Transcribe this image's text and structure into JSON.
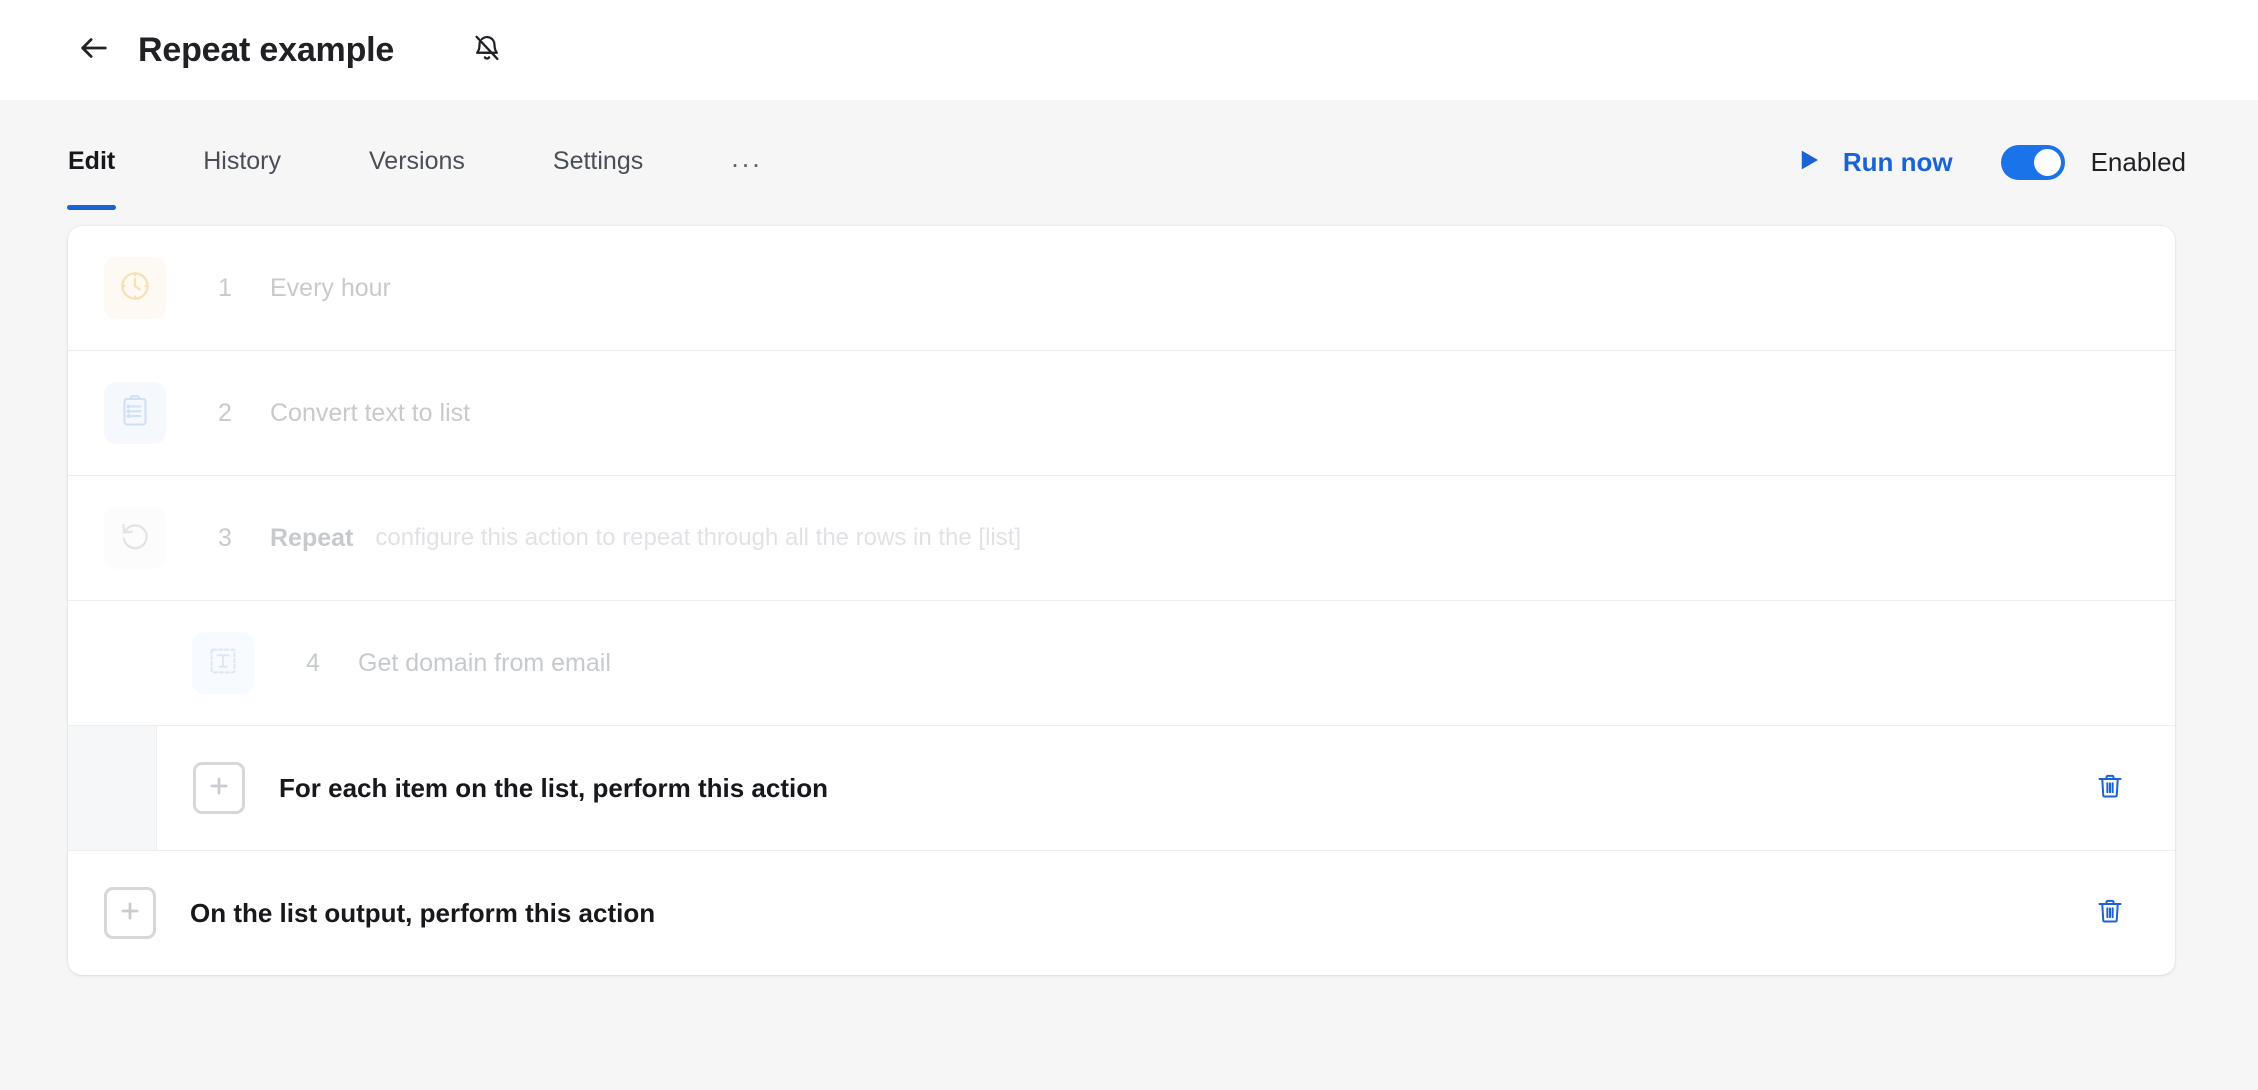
{
  "header": {
    "back_icon": "arrow-left-icon",
    "title": "Repeat example",
    "notification_icon": "bell-off-icon"
  },
  "tabbar": {
    "tabs": [
      {
        "label": "Edit",
        "active": true
      },
      {
        "label": "History",
        "active": false
      },
      {
        "label": "Versions",
        "active": false
      },
      {
        "label": "Settings",
        "active": false
      }
    ],
    "overflow_label": "...",
    "run_now": {
      "label": "Run now",
      "icon": "play-icon",
      "color": "#1a62d6"
    },
    "toggle": {
      "label": "Enabled",
      "on": true,
      "color": "#1a73e8"
    },
    "active_underline_color": "#1a62d6"
  },
  "workflow": {
    "steps": [
      {
        "number": "1",
        "title": "Every hour",
        "subtitle": "",
        "icon": "clock-icon",
        "tile_color": "#fdf4e3",
        "indent": false,
        "dimmed": true
      },
      {
        "number": "2",
        "title": "Convert text to list",
        "subtitle": "",
        "icon": "clipboard-list-icon",
        "tile_color": "#e9f1fd",
        "indent": false,
        "dimmed": true
      },
      {
        "number": "3",
        "title": "Repeat",
        "subtitle": "configure this action to repeat through all the rows in the [list]",
        "icon": "repeat-rotate-icon",
        "tile_color": "#fafafb",
        "indent": false,
        "dimmed": true
      },
      {
        "number": "4",
        "title": "Get domain from email",
        "subtitle": "",
        "icon": "text-select-icon",
        "tile_color": "#eef5fd",
        "indent": true,
        "dimmed": true
      }
    ],
    "actions": [
      {
        "label": "For each item on the list, perform this action",
        "add_icon": "plus-square-icon",
        "delete_icon": "trash-icon",
        "nested": true
      },
      {
        "label": "On the list output, perform this action",
        "add_icon": "plus-square-icon",
        "delete_icon": "trash-icon",
        "nested": false
      }
    ]
  }
}
